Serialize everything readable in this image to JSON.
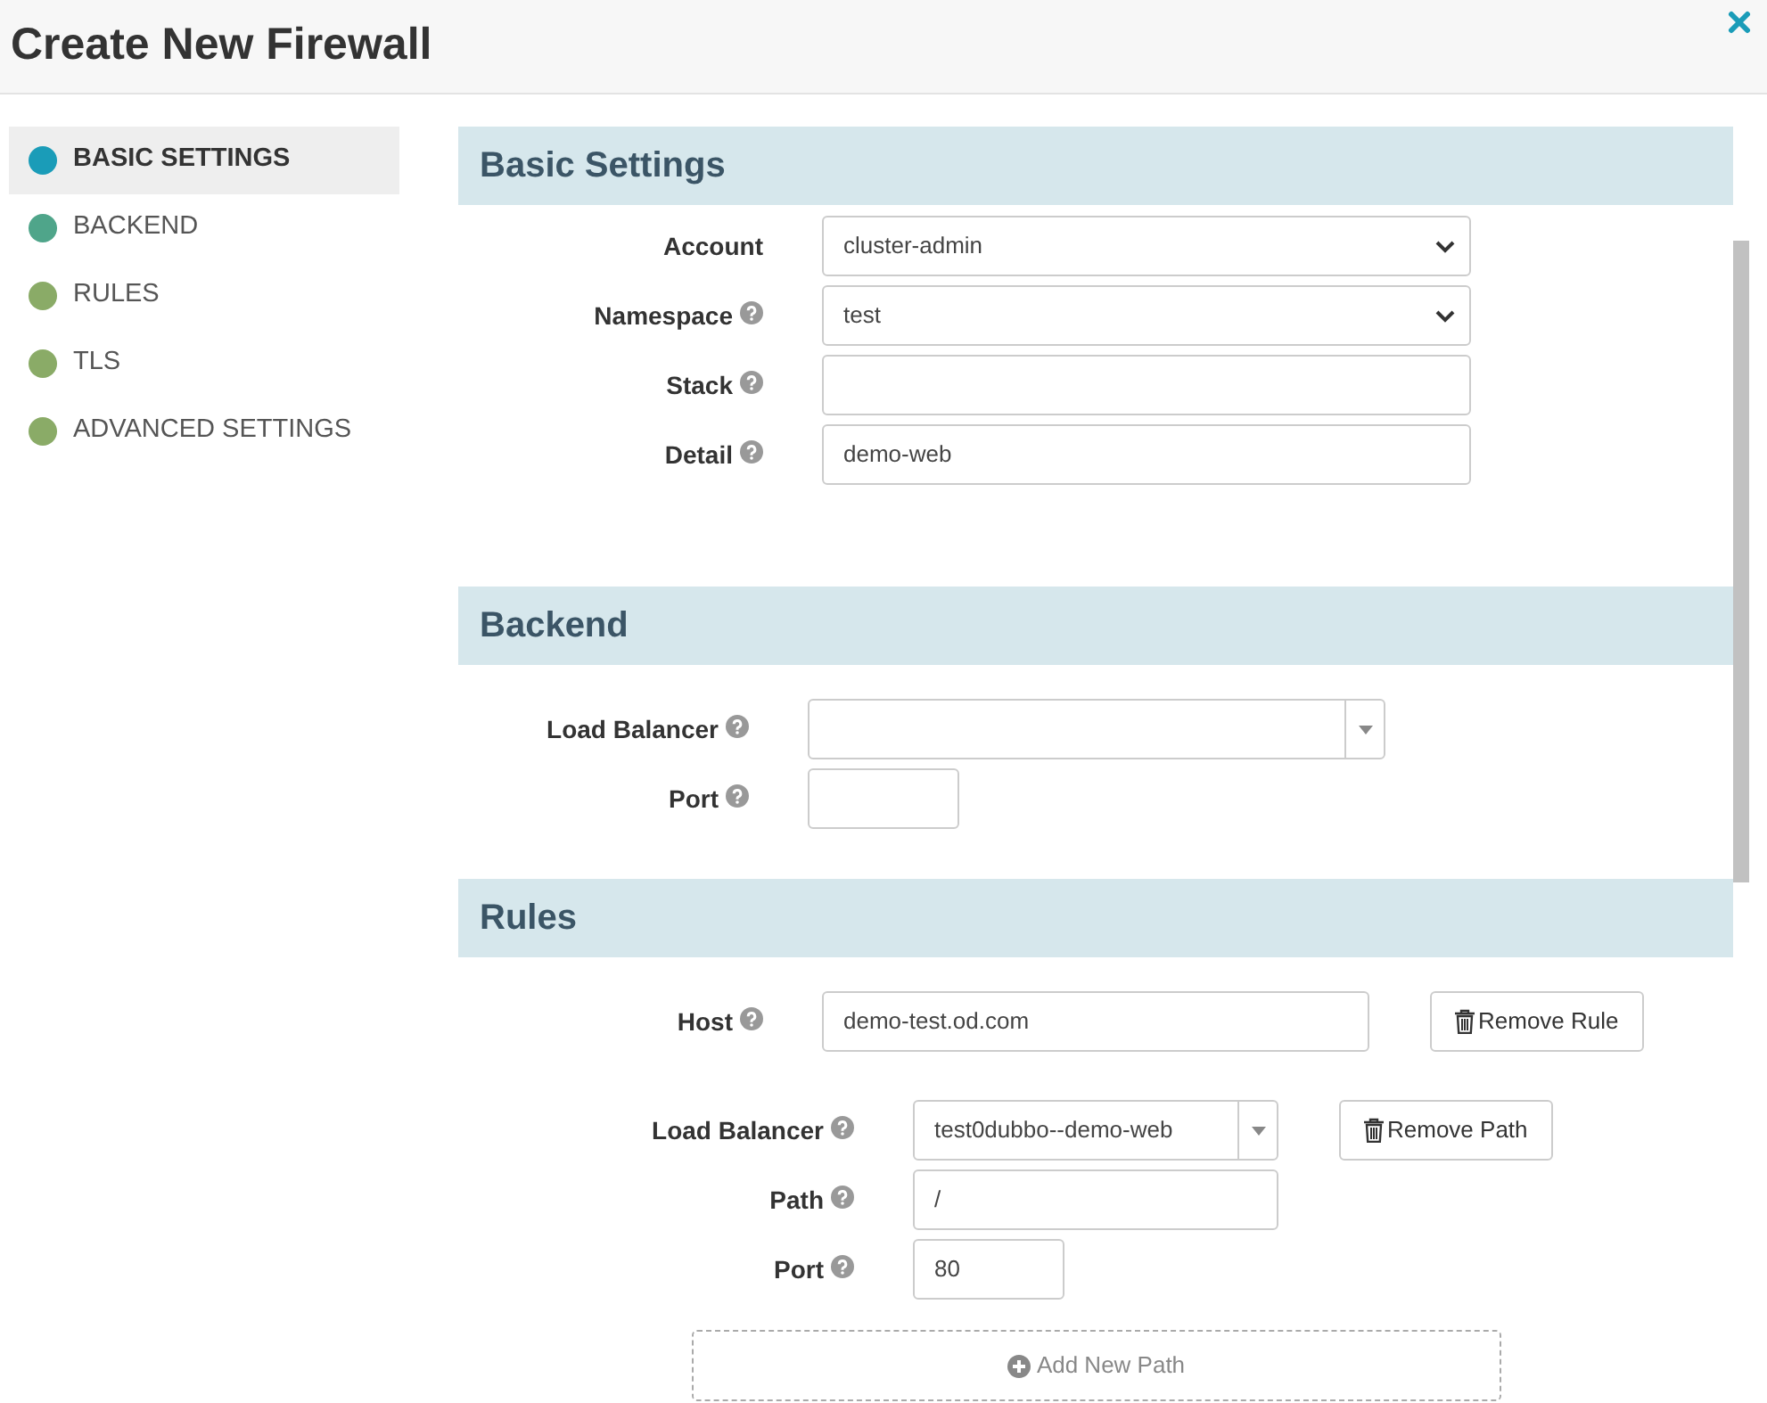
{
  "window": {
    "title": "Create New Firewall"
  },
  "sidebar": {
    "items": [
      {
        "label": "BASIC SETTINGS",
        "selected": true,
        "color": "#1a9cb8"
      },
      {
        "label": "BACKEND",
        "selected": false,
        "color": "#4fa58a"
      },
      {
        "label": "RULES",
        "selected": false,
        "color": "#8aab67"
      },
      {
        "label": "TLS",
        "selected": false,
        "color": "#8aab67"
      },
      {
        "label": "ADVANCED SETTINGS",
        "selected": false,
        "color": "#8aab67"
      }
    ]
  },
  "sections": [
    {
      "title": "Basic Settings",
      "groups": [
        {
          "rows": [
            {
              "label": "Account",
              "help": false,
              "kind": "select",
              "value": "cluster-admin"
            },
            {
              "label": "Namespace",
              "help": true,
              "kind": "select",
              "value": "test"
            },
            {
              "label": "Stack",
              "help": true,
              "kind": "input"
            },
            {
              "label": "Detail",
              "help": true,
              "kind": "input",
              "value": "demo-web"
            }
          ]
        }
      ]
    },
    {
      "title": "Backend",
      "groups": [
        {
          "rows": [
            {
              "label": "Load Balancer",
              "help": true,
              "kind": "combo"
            },
            {
              "label": "Port",
              "help": true,
              "kind": "input"
            }
          ]
        }
      ]
    },
    {
      "title": "Rules",
      "groups": [
        {
          "rows": [
            {
              "label": "Host",
              "help": true,
              "kind": "input",
              "value": "demo-test.od.com",
              "button": "Remove Rule"
            }
          ]
        },
        {
          "rows": [
            {
              "label": "Load Balancer",
              "help": true,
              "kind": "combo",
              "value": "test0dubbo--demo-web",
              "button": "Remove Path"
            },
            {
              "label": "Path",
              "help": true,
              "kind": "input",
              "value": "/"
            },
            {
              "label": "Port",
              "help": true,
              "kind": "input",
              "value": "80"
            }
          ]
        }
      ],
      "add_button": "Add New Path"
    }
  ]
}
